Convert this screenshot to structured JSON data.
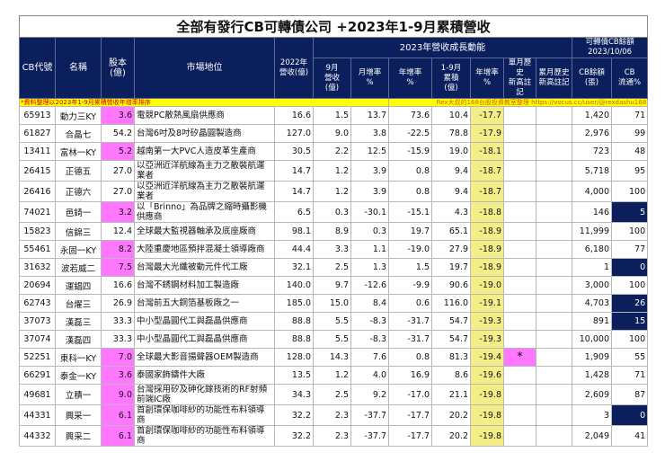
{
  "title": "全部有發行CB可轉債公司 +2023年1-9月累積營收",
  "headers": {
    "code": "CB代號",
    "name": "名稱",
    "capital": "股本\n(億)",
    "market": "市場地位",
    "rev2022": "2022年\n營收(億)",
    "group2023": "2023年營收成長動能",
    "groupCB": "可轉債CB餘額\n2023/10/06",
    "sep": "9月\n營收\n(億)",
    "mom": "月增率\n%",
    "yoy": "年增率\n%",
    "ytd": "1-9月\n累積\n(億)",
    "ytdyoy": "年增率\n%",
    "singleHigh": "單月歷史\n新高註記",
    "cumHigh": "累月歷史\n新高註記",
    "cbBal": "CB餘額\n(張)",
    "cbFlow": "CB\n流通%"
  },
  "note_left": "*資料整理以2023年1-9月累積營收年增率排序",
  "note_right": "Rex大叔的168台股投資教室整理 https://vocus.cc/user/@rexdashu168",
  "rows": [
    [
      "65913",
      "動力三KY",
      "3.6",
      "電競PC散熱風扇供應商",
      "16.6",
      "1.5",
      "13.7",
      "73.6",
      "10.4",
      "-17.7",
      "",
      "",
      "1,420",
      "71"
    ],
    [
      "61827",
      "合晶七",
      "54.2",
      "台灣6吋及8吋矽晶圓製造商",
      "127.0",
      "9.0",
      "3.8",
      "-22.5",
      "78.8",
      "-17.9",
      "",
      "",
      "2,976",
      "99"
    ],
    [
      "13411",
      "富林一KY",
      "5.2",
      "越南第一大PVC人造皮革生產商",
      "30.5",
      "2.2",
      "12.5",
      "-15.9",
      "19.0",
      "-18.1",
      "",
      "",
      "723",
      "48"
    ],
    [
      "26415",
      "正德五",
      "27.0",
      "以亞洲近洋航線為主力之散裝航運業者",
      "14.7",
      "1.2",
      "3.9",
      "0.8",
      "9.4",
      "-18.7",
      "",
      "",
      "5,718",
      "95"
    ],
    [
      "26416",
      "正德六",
      "27.0",
      "以亞洲近洋航線為主力之散裝航運業者",
      "14.7",
      "1.2",
      "3.9",
      "0.8",
      "9.4",
      "-18.7",
      "",
      "",
      "4,000",
      "100"
    ],
    [
      "74021",
      "邑錡一",
      "3.2",
      "以「Brinno」為品牌之縮時攝影機供應商",
      "6.5",
      "0.3",
      "-30.1",
      "-15.1",
      "4.3",
      "-18.8",
      "",
      "",
      "146",
      "5"
    ],
    [
      "15823",
      "信錦三",
      "12.4",
      "全球最大監視器軸承及底座廠商",
      "98.1",
      "8.9",
      "0.3",
      "19.7",
      "65.1",
      "-18.9",
      "",
      "",
      "11,999",
      "100"
    ],
    [
      "55461",
      "永固一KY",
      "8.2",
      "大陸重慶地區預拌混凝土領導廠商",
      "44.4",
      "3.3",
      "1.1",
      "-19.0",
      "27.9",
      "-18.9",
      "",
      "",
      "6,180",
      "77"
    ],
    [
      "31632",
      "波若威二",
      "7.5",
      "台灣最大光纖被動元件代工廠",
      "32.1",
      "2.5",
      "1.3",
      "1.5",
      "19.7",
      "-18.9",
      "",
      "",
      "1",
      "0"
    ],
    [
      "20694",
      "運錩四",
      "16.6",
      "台灣不銹鋼材料加工製造廠",
      "140.0",
      "9.7",
      "-12.6",
      "-9.9",
      "90.6",
      "-19.0",
      "",
      "",
      "3,000",
      "100"
    ],
    [
      "62743",
      "台燿三",
      "26.9",
      "台灣前五大銅箔基板廠之一",
      "185.0",
      "15.0",
      "8.4",
      "0.6",
      "116.0",
      "-19.1",
      "",
      "",
      "4,703",
      "26"
    ],
    [
      "37073",
      "漢磊三",
      "33.3",
      "中小型晶圓代工與磊晶供應商",
      "88.8",
      "5.5",
      "-8.3",
      "-31.7",
      "54.7",
      "-19.3",
      "",
      "",
      "891",
      "15"
    ],
    [
      "37074",
      "漢磊四",
      "33.3",
      "中小型晶圓代工與磊晶供應商",
      "88.8",
      "5.5",
      "-8.3",
      "-31.7",
      "54.7",
      "-19.3",
      "",
      "",
      "10,000",
      "100"
    ],
    [
      "52251",
      "東科一KY",
      "7.0",
      "全球最大影音揚聲器OEM製造商",
      "128.0",
      "14.3",
      "7.6",
      "0.8",
      "81.3",
      "-19.4",
      "*",
      "",
      "1,909",
      "55"
    ],
    [
      "66291",
      "泰金一KY",
      "3.6",
      "泰國家飾鑄件大廠",
      "13.5",
      "1.2",
      "4.0",
      "16.9",
      "8.6",
      "-19.6",
      "",
      "",
      "1,428",
      "71"
    ],
    [
      "49681",
      "立積一",
      "9.0",
      "台灣採用矽及砷化鎵技術的RF射頻前端IC廠",
      "34.3",
      "2.5",
      "9.2",
      "-17.0",
      "21.1",
      "-19.8",
      "",
      "",
      "2,609",
      "87"
    ],
    [
      "44331",
      "興采一",
      "6.1",
      "首創環保咖啡紗的功能性布料領導商",
      "32.2",
      "2.3",
      "-37.7",
      "-17.7",
      "20.2",
      "-19.8",
      "",
      "",
      "3",
      "0"
    ],
    [
      "44332",
      "興采二",
      "6.1",
      "首創環保咖啡紗的功能性布料領導商",
      "32.2",
      "2.3",
      "-37.7",
      "-17.7",
      "20.2",
      "-19.8",
      "",
      "",
      "2,049",
      "41"
    ]
  ],
  "colors": {
    "header": "#0b1f5c",
    "pink": "#ff77ff",
    "yellow": "#f3ee88",
    "note": "#ffff00"
  }
}
